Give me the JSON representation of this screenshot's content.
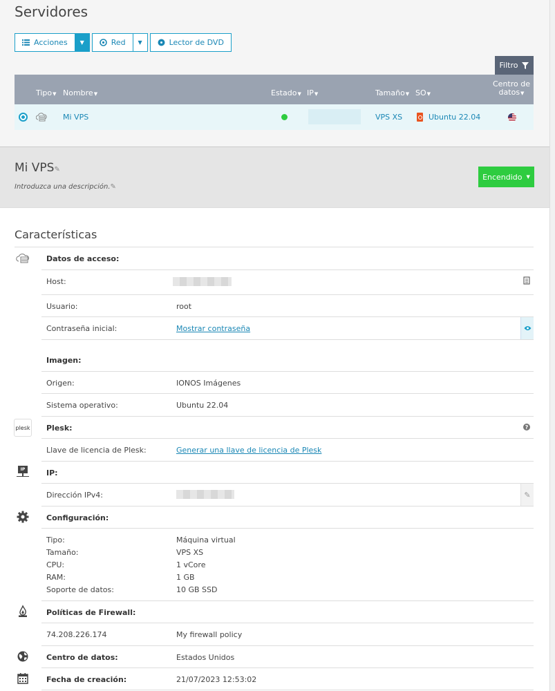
{
  "page_title": "Servidores",
  "toolbar": {
    "actions_label": "Acciones",
    "network_label": "Red",
    "dvd_label": "Lector de DVD",
    "filter_label": "Filtro"
  },
  "table": {
    "headers": {
      "type": "Tipo",
      "name": "Nombre",
      "status": "Estado",
      "ip": "IP",
      "size": "Tamaño",
      "os": "SO",
      "datacenter": "Centro de datos"
    },
    "row": {
      "name": "Mi VPS",
      "size": "VPS XS",
      "os": "Ubuntu 22.04",
      "status_color": "#2ecc40"
    }
  },
  "server": {
    "name": "Mi VPS",
    "description_placeholder": "Introduzca una descripción.",
    "power_label": "Encendido"
  },
  "characteristics": {
    "title": "Características",
    "access": {
      "heading": "Datos de acceso:",
      "host_label": "Host:",
      "user_label": "Usuario:",
      "user_value": "root",
      "password_label": "Contraseña inicial:",
      "password_link": "Mostrar contraseña"
    },
    "image": {
      "heading": "Imagen:",
      "origin_label": "Origen:",
      "origin_value": "IONOS Imágenes",
      "os_label": "Sistema operativo:",
      "os_value": "Ubuntu 22.04"
    },
    "plesk": {
      "logo_text": "plesk",
      "heading": "Plesk:",
      "license_label": "Llave de licencia de Plesk:",
      "license_link": "Generar una llave de licencia de Plesk"
    },
    "ip": {
      "icon_text": "IP",
      "heading": "IP:",
      "ipv4_label": "Dirección IPv4:"
    },
    "config": {
      "heading": "Configuración:",
      "items": [
        {
          "label": "Tipo:",
          "value": "Máquina virtual"
        },
        {
          "label": "Tamaño:",
          "value": "VPS XS"
        },
        {
          "label": "CPU:",
          "value": "1 vCore"
        },
        {
          "label": "RAM:",
          "value": "1 GB"
        },
        {
          "label": "Soporte de datos:",
          "value": "10 GB SSD"
        }
      ]
    },
    "firewall": {
      "heading": "Políticas de Firewall:",
      "ip": "74.208.226.174",
      "policy": "My firewall policy"
    },
    "datacenter": {
      "label": "Centro de datos:",
      "value": "Estados Unidos"
    },
    "created": {
      "label": "Fecha de creación:",
      "value": "21/07/2023 12:53:02"
    }
  },
  "colors": {
    "accent": "#1a9fc9",
    "link": "#1a87b5",
    "power": "#2ecc40",
    "header_bg": "#9aa3b1",
    "filter_bg": "#5a6577"
  }
}
